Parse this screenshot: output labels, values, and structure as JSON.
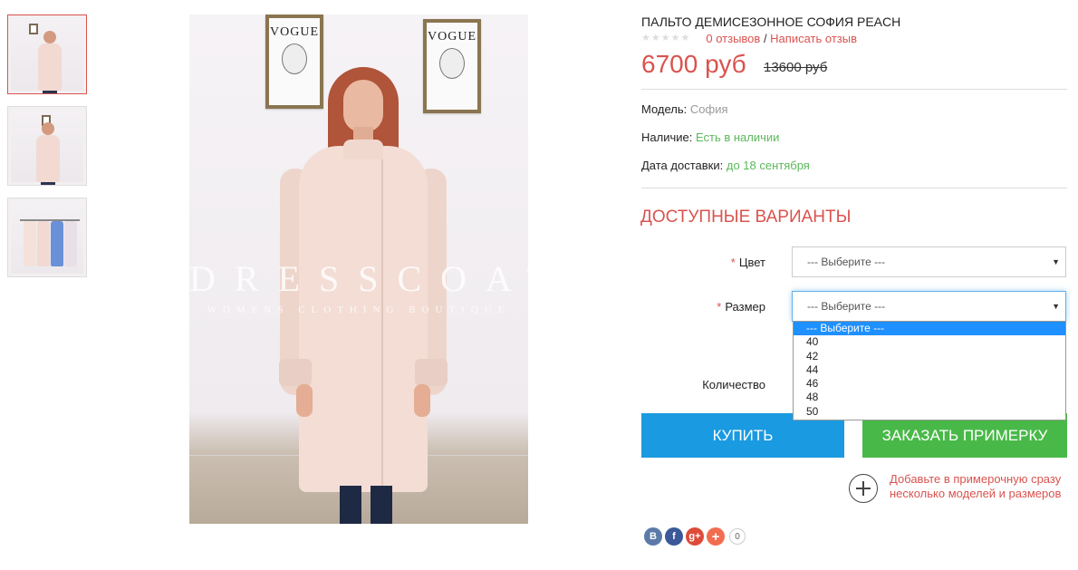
{
  "gallery": {
    "thumbnails": [
      {
        "alt": "thumb-1"
      },
      {
        "alt": "thumb-2"
      },
      {
        "alt": "thumb-3"
      }
    ],
    "main_photo": {
      "watermark": "DRESSCOAT",
      "watermark_sub": "WOMENS CLOTHING BOUTIQUE",
      "frame_text": "VOGUE"
    }
  },
  "product": {
    "title": "ПАЛЬТО ДЕМИСЕЗОННОЕ СОФИЯ PEACH",
    "rating_stars": 0,
    "reviews_link": "0 отзывов",
    "separator": " / ",
    "write_review_link": "Написать отзыв",
    "price": "6700 руб",
    "old_price": "13600 руб",
    "specs": {
      "model_label": "Модель:",
      "model_value": "София",
      "stock_label": "Наличие:",
      "stock_value": "Есть в наличии",
      "delivery_label": "Дата доставки:",
      "delivery_value": "до 18 сентября"
    }
  },
  "options": {
    "heading": "ДОСТУПНЫЕ ВАРИАНТЫ",
    "color_label": "Цвет",
    "color_value": "--- Выберите ---",
    "size_label": "Размер",
    "size_value": "--- Выберите ---",
    "size_options": [
      "--- Выберите ---",
      "40",
      "42",
      "44",
      "46",
      "48",
      "50"
    ],
    "quantity_label": "Количество",
    "required_mark": "*"
  },
  "actions": {
    "buy_label": "КУПИТЬ",
    "fitting_label": "ЗАКАЗАТЬ ПРИМЕРКУ",
    "fitting_note": "Добавьте в примерочную сразу несколько моделей и размеров"
  },
  "share": {
    "vk": "B",
    "fb": "f",
    "gplus": "g+",
    "more": "+",
    "count": "0"
  },
  "colors": {
    "accent": "#d9534f",
    "buy": "#1a9ae0",
    "fitting": "#48b948",
    "in_stock": "#5cb85c"
  }
}
